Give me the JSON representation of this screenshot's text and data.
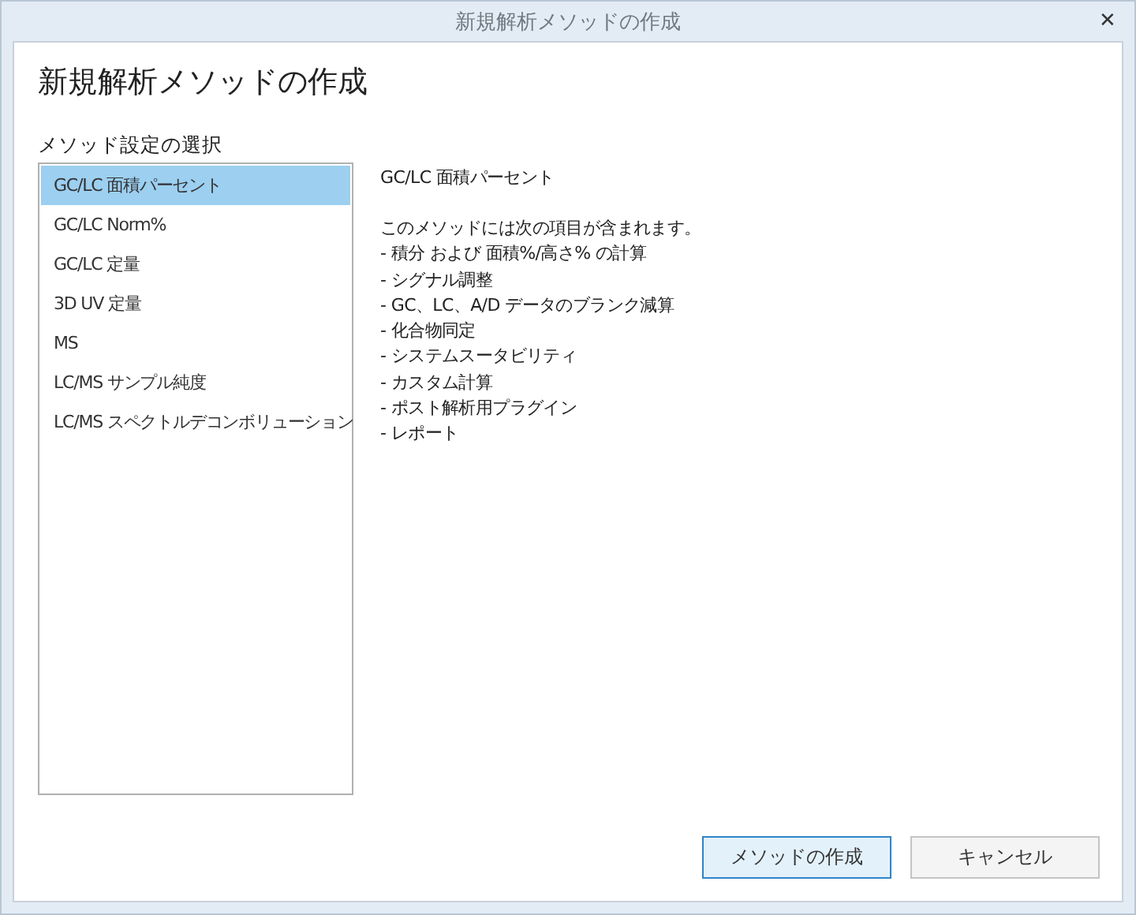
{
  "window": {
    "title": "新規解析メソッドの作成",
    "close": "✕"
  },
  "heading": "新規解析メソッドの作成",
  "list_label": "メソッド設定の選択",
  "methods": [
    {
      "label": "GC/LC 面積パーセント",
      "selected": true
    },
    {
      "label": "GC/LC Norm%",
      "selected": false
    },
    {
      "label": "GC/LC 定量",
      "selected": false
    },
    {
      "label": "3D UV 定量",
      "selected": false
    },
    {
      "label": "MS",
      "selected": false
    },
    {
      "label": "LC/MS サンプル純度",
      "selected": false
    },
    {
      "label": "LC/MS スペクトルデコンボリューション",
      "selected": false
    }
  ],
  "description": {
    "title": "GC/LC 面積パーセント",
    "intro": "このメソッドには次の項目が含まれます。",
    "items": [
      "- 積分 および 面積%/高さ% の計算",
      "- シグナル調整",
      "- GC、LC、A/D データのブランク減算",
      "- 化合物同定",
      "- システムスータビリティ",
      "- カスタム計算",
      "- ポスト解析用プラグイン",
      "- レポート"
    ]
  },
  "buttons": [
    {
      "label": "メソッドの作成",
      "default": true
    },
    {
      "label": "キャンセル",
      "default": false
    }
  ]
}
